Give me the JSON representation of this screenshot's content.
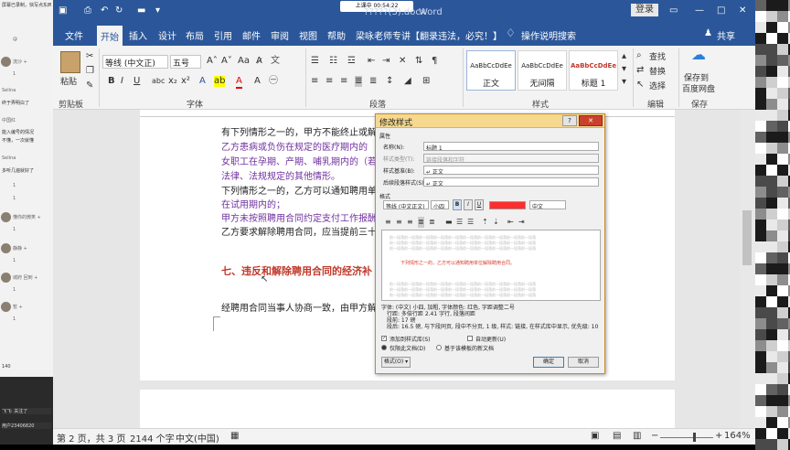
{
  "left_panel": {
    "items": [
      {
        "text": "屏幕已录制，快写点东西"
      },
      {
        "text": "@"
      },
      {
        "text": "流沙 +"
      },
      {
        "text": "1"
      },
      {
        "text": "Selina"
      },
      {
        "text": "终于弄明白了"
      },
      {
        "text": "中国红"
      },
      {
        "text": "能入编号的情况"
      },
      {
        "text": "不懂，一次就懂"
      },
      {
        "text": "Selina"
      },
      {
        "text": "多听几遍就好了"
      },
      {
        "text": "1"
      },
      {
        "text": "1"
      },
      {
        "text": "懂你的微笑 +"
      },
      {
        "text": "1"
      },
      {
        "text": "静静 +"
      },
      {
        "text": "1"
      },
      {
        "text": "城府 回到 +"
      },
      {
        "text": "1"
      },
      {
        "text": "暂 +"
      },
      {
        "text": "1"
      },
      {
        "text": "140"
      },
      {
        "text": "飞飞: 关注了"
      },
      {
        "text": "用户23406820"
      }
    ]
  },
  "titlebar": {
    "doc_title": "Word",
    "doc_name": "?????(3).docx",
    "recording": "上课中 00:54:22",
    "login": "登录"
  },
  "tabs": [
    "文件",
    "开始",
    "插入",
    "设计",
    "布局",
    "引用",
    "邮件",
    "审阅",
    "视图",
    "帮助",
    "梁咏老师专讲【翻录违法，必究！】",
    "操作说明搜索"
  ],
  "share": "共享",
  "ribbon": {
    "paste": "粘贴",
    "clipboard": "剪贴板",
    "font_name": "等线 (中文正)",
    "font_size": "五号",
    "font_group": "字体",
    "paragraph_group": "段落",
    "styles": [
      {
        "sample": "AaBbCcDdEe",
        "name": "正文"
      },
      {
        "sample": "AaBbCcDdEe",
        "name": "无间隔"
      },
      {
        "sample": "AaBbCcDdEe",
        "name": "标题 1"
      }
    ],
    "styles_group": "样式",
    "find": "查找",
    "replace": "替换",
    "select": "选择",
    "edit_group": "编辑",
    "save_to": "保存到",
    "baidu": "百度网盘",
    "save_group": "保存"
  },
  "document": {
    "lines": [
      {
        "text": "有下列情形之一的，甲方不能终止或解除",
        "style": "normal"
      },
      {
        "text": "乙方患病或负伤在规定的医疗期内的",
        "style": "purple"
      },
      {
        "text": "女职工在孕期、产期、哺乳期内的（若",
        "style": "purple"
      },
      {
        "text": "法律、法规规定的其他情形。",
        "style": "purple"
      },
      {
        "text": "下列情形之一的，乙方可以通知聘用单",
        "style": "normal"
      },
      {
        "text": "在试用期内的；",
        "style": "purple"
      },
      {
        "text": "甲方未按照聘用合同约定支付工作报酬",
        "style": "purple"
      },
      {
        "text": "乙方要求解除聘用合同，应当提前三十",
        "style": "normal"
      },
      {
        "text": "七、违反和解除聘用合同的经济补",
        "style": "red"
      },
      {
        "text": "经聘用合同当事人协商一致，由甲方解",
        "style": "normal"
      }
    ]
  },
  "dialog": {
    "title": "修改样式",
    "section_props": "属性",
    "name_label": "名称(N):",
    "name_value": "标题 1",
    "type_label": "样式类型(T):",
    "type_value": "链接段落和字符",
    "based_label": "样式基准(B):",
    "based_value": "↵ 正文",
    "next_label": "后续段落样式(S):",
    "next_value": "↵ 正文",
    "section_format": "格式",
    "font": "等线 (中文正文)",
    "size": "小四",
    "bold": "B",
    "italic": "I",
    "underline": "U",
    "color_hex": "#ff2d2d",
    "lang": "中文",
    "preview_text": "下列情形之一的，乙方可以通知聘用单位解除聘用合同。",
    "preview_filler": "前一段落前一段落前一段落前一段落前一段落前一段落前一段落前一段落前一段落前一段落",
    "desc_lines": [
      "字体: (中文) 小四, 加粗, 字体颜色: 红色, 字距调整二号",
      "行距: 多倍行距 2.41 字行, 段落间距",
      "段前: 17 磅",
      "段后: 16.5 磅, 与下段同页, 段中不分页, 1 级, 样式: 链接, 在样式库中显示, 优先级: 10"
    ],
    "add_to_gallery": "添加到样式库(S)",
    "auto_update": "自动更新(U)",
    "only_this_doc": "仅限此文档(D)",
    "new_docs": "基于该模板的新文档",
    "format_btn": "格式(O) ▾",
    "ok_btn": "确定",
    "cancel_btn": "取消"
  },
  "status": {
    "page": "第 2 页，共 3 页",
    "words": "2144 个字",
    "lang": "中文(中国)",
    "zoom": "164%"
  }
}
